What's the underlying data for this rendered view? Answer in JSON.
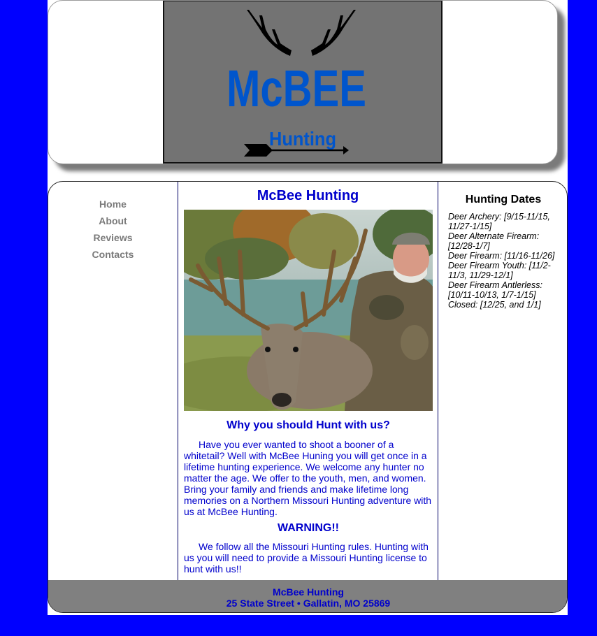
{
  "header": {
    "logo_title": "McBEE",
    "logo_subtitle": "Hunting"
  },
  "nav": {
    "items": [
      {
        "label": "Home"
      },
      {
        "label": "About"
      },
      {
        "label": "Reviews"
      },
      {
        "label": "Contacts"
      }
    ]
  },
  "content": {
    "title": "McBee Hunting",
    "why_title": "Why you should Hunt with us?",
    "why_text": "Have you ever wanted to shoot a booner of a whitetail? Well with McBee Huning you will get once in a lifetime hunting experience. We welcome any hunter no matter the age. We offer to the youth, men, and women. Bring your family and friends and make lifetime long memories on a Northern Missouri Hunting adventure with us at McBee Hunting.",
    "warning_title": "WARNING!!",
    "warning_text": "We follow all the Missouri Hunting rules. Hunting with us you will need to provide a Missouri Hunting license to hunt with us!!"
  },
  "aside": {
    "title": "Hunting Dates",
    "dates": [
      "Deer Archery: [9/15-11/15, 11/27-1/15]",
      "Deer Alternate Firearm: [12/28-1/7]",
      "Deer Firearm: [11/16-11/26]",
      "Deer Firearm Youth: [11/2-11/3, 11/29-12/1]",
      "Deer Firearm Antlerless: [10/11-10/13, 1/7-1/15]",
      "Closed: [12/25, and 1/1]"
    ]
  },
  "footer": {
    "name": "McBee Hunting",
    "address": "25 State Street • Gallatin, MO 25869"
  },
  "colors": {
    "background": "#0000ff",
    "text_accent": "#0000cc",
    "nav_text": "#7a7a7a",
    "footer_bg": "#808080",
    "logo_bg": "#737373",
    "logo_text": "#0055cc"
  }
}
